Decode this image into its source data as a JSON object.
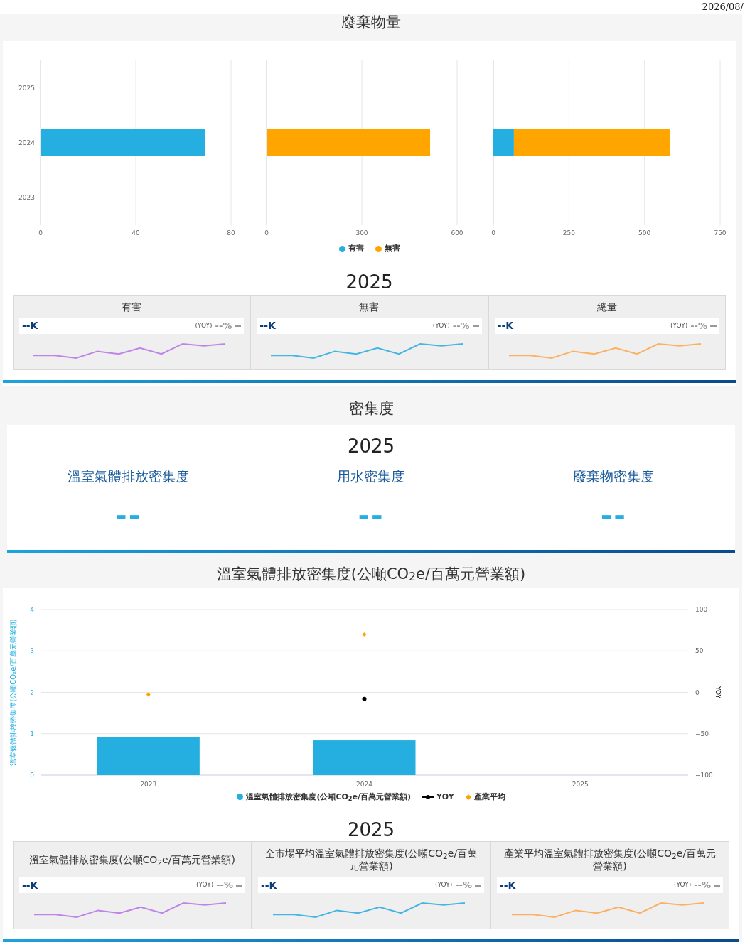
{
  "header_date": "2026/08/",
  "waste": {
    "title": "廢棄物量",
    "panels": [
      {
        "chart_data": {
          "type": "bar",
          "orientation": "horizontal",
          "grid": true,
          "categories": [
            "2025",
            "2024",
            "2023"
          ],
          "xlim": [
            0,
            80
          ],
          "xticks": [
            0,
            40,
            80
          ],
          "series": [
            {
              "color": "#25aee0",
              "values": [
                null,
                69,
                null
              ]
            }
          ]
        }
      },
      {
        "chart_data": {
          "type": "bar",
          "orientation": "horizontal",
          "grid": true,
          "xlim": [
            0,
            600
          ],
          "xticks": [
            0,
            300,
            600
          ],
          "series": [
            {
              "color": "#ffa500",
              "values": [
                null,
                515,
                null
              ]
            }
          ]
        }
      },
      {
        "chart_data": {
          "type": "bar",
          "orientation": "horizontal",
          "grid": true,
          "stacked": true,
          "xlim": [
            0,
            750
          ],
          "xticks": [
            0,
            250,
            500,
            750
          ],
          "series": [
            {
              "name": "有害",
              "color": "#25aee0",
              "values": [
                null,
                68,
                null
              ]
            },
            {
              "name": "無害",
              "color": "#ffa500",
              "values": [
                null,
                515,
                null
              ]
            }
          ]
        }
      }
    ],
    "year": "2025",
    "cards": [
      {
        "title": "有害",
        "value": "--K",
        "yoy_label": "(YOY)",
        "yoy": "--%",
        "color": "#c084e8"
      },
      {
        "title": "無害",
        "value": "--K",
        "yoy_label": "(YOY)",
        "yoy": "--%",
        "color": "#45b5e3"
      },
      {
        "title": "總量",
        "value": "--K",
        "yoy_label": "(YOY)",
        "yoy": "--%",
        "color": "#fbb062"
      }
    ]
  },
  "density": {
    "title": "密集度",
    "year": "2025",
    "metrics": [
      {
        "label": "溫室氣體排放密集度",
        "value": "--"
      },
      {
        "label": "用水密集度",
        "value": "--"
      },
      {
        "label": "廢棄物密集度",
        "value": "--"
      }
    ]
  },
  "ghg": {
    "title": "溫室氣體排放密集度(公噸CO$_{2}$e/百萬元營業額)",
    "chart_data": {
      "type": "bar",
      "grid": true,
      "legend": true,
      "categories": [
        "2023",
        "2024",
        "2025"
      ],
      "ylabel": "溫室氣體排放密集度(公噸CO₂e/百萬元營業額)",
      "y2label": "YOY",
      "ylim": [
        0,
        4
      ],
      "yticks": [
        0,
        1,
        2,
        3,
        4
      ],
      "y2lim": [
        -100,
        100
      ],
      "y2ticks": [
        {
          "value": -100,
          "label": "−100"
        },
        {
          "value": -50,
          "label": "−50"
        },
        0,
        50,
        100
      ],
      "series": [
        {
          "name": "溫室氣體排放密集度(公噸CO$_{2}$e/百萬元營業額)",
          "type": "bar",
          "color": "#25aee0",
          "values": [
            0.92,
            0.84,
            null
          ]
        },
        {
          "name": "YOY",
          "type": "line",
          "axis": "y2",
          "marker": "circle",
          "color": "#000000",
          "values": [
            null,
            -8,
            null
          ]
        },
        {
          "name": "產業平均",
          "type": "scatter",
          "color": "#ffa500",
          "values": [
            1.95,
            3.4,
            null
          ]
        }
      ]
    },
    "year": "2025",
    "cards": [
      {
        "title": "溫室氣體排放密集度(公噸CO$_{2}$e/百萬元營業額)",
        "value": "--K",
        "yoy_label": "(YOY)",
        "yoy": "--%",
        "color": "#c084e8"
      },
      {
        "title": "全市場平均溫室氣體排放密集度(公噸CO$_{2}$e/百萬元營業額)",
        "value": "--K",
        "yoy_label": "(YOY)",
        "yoy": "--%",
        "color": "#45b5e3"
      },
      {
        "title": "產業平均溫室氣體排放密集度(公噸CO$_{2}$e/百萬元營業額)",
        "value": "--K",
        "yoy_label": "(YOY)",
        "yoy": "--%",
        "color": "#fbb062"
      }
    ]
  }
}
